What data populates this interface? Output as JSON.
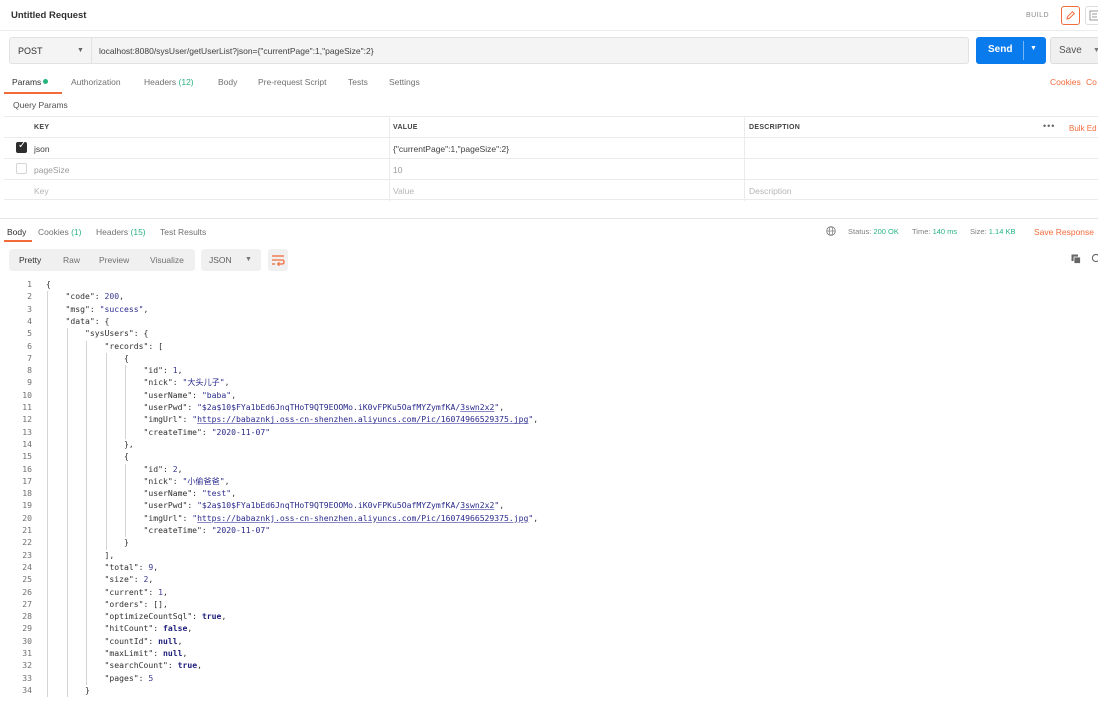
{
  "header": {
    "title": "Untitled Request",
    "build_label": "BUILD"
  },
  "request": {
    "method": "POST",
    "url": "localhost:8080/sysUser/getUserList?json={\"currentPage\":1,\"pageSize\":2}",
    "send_label": "Send",
    "save_label": "Save"
  },
  "request_tabs": {
    "params": "Params",
    "authorization": "Authorization",
    "headers": "Headers",
    "headers_count": "(12)",
    "body": "Body",
    "prerequest": "Pre-request Script",
    "tests": "Tests",
    "settings": "Settings",
    "cookies_link": "Cookies",
    "code_link": "Co"
  },
  "query_params": {
    "label": "Query Params",
    "columns": [
      "KEY",
      "VALUE",
      "DESCRIPTION"
    ],
    "bulk_edit": "Bulk Ed",
    "rows": [
      {
        "checked": true,
        "key": "json",
        "value": "{\"currentPage\":1,\"pageSize\":2}",
        "description": ""
      },
      {
        "checked": false,
        "key": "pageSize",
        "value": "10",
        "description": ""
      }
    ],
    "placeholder": {
      "key": "Key",
      "value": "Value",
      "description": "Description"
    }
  },
  "response_tabs": {
    "body": "Body",
    "cookies": "Cookies",
    "cookies_count": "(1)",
    "headers": "Headers",
    "headers_count": "(15)",
    "test_results": "Test Results"
  },
  "response_status": {
    "status_label": "Status:",
    "status_value": "200 OK",
    "time_label": "Time:",
    "time_value": "140 ms",
    "size_label": "Size:",
    "size_value": "1.14 KB",
    "save_response": "Save Response"
  },
  "view_modes": {
    "pretty": "Pretty",
    "raw": "Raw",
    "preview": "Preview",
    "visualize": "Visualize",
    "format": "JSON"
  },
  "response_body": [
    {
      "n": "1",
      "tokens": [
        {
          "c": "k",
          "t": "{"
        }
      ]
    },
    {
      "n": "2",
      "tokens": [
        {
          "c": "k",
          "t": "    \"code\": "
        },
        {
          "c": "n",
          "t": "200"
        },
        {
          "c": "k",
          "t": ","
        }
      ]
    },
    {
      "n": "3",
      "tokens": [
        {
          "c": "k",
          "t": "    \"msg\": "
        },
        {
          "c": "s",
          "t": "\"success\""
        },
        {
          "c": "k",
          "t": ","
        }
      ]
    },
    {
      "n": "4",
      "tokens": [
        {
          "c": "k",
          "t": "    \"data\": {"
        }
      ]
    },
    {
      "n": "5",
      "tokens": [
        {
          "c": "k",
          "t": "        \"sysUsers\": {"
        }
      ]
    },
    {
      "n": "6",
      "tokens": [
        {
          "c": "k",
          "t": "            \"records\": ["
        }
      ]
    },
    {
      "n": "7",
      "tokens": [
        {
          "c": "k",
          "t": "                {"
        }
      ]
    },
    {
      "n": "8",
      "tokens": [
        {
          "c": "k",
          "t": "                    \"id\": "
        },
        {
          "c": "n",
          "t": "1"
        },
        {
          "c": "k",
          "t": ","
        }
      ]
    },
    {
      "n": "9",
      "tokens": [
        {
          "c": "k",
          "t": "                    \"nick\": "
        },
        {
          "c": "s",
          "t": "\"大头儿子\""
        },
        {
          "c": "k",
          "t": ","
        }
      ]
    },
    {
      "n": "10",
      "tokens": [
        {
          "c": "k",
          "t": "                    \"userName\": "
        },
        {
          "c": "s",
          "t": "\"baba\""
        },
        {
          "c": "k",
          "t": ","
        }
      ]
    },
    {
      "n": "11",
      "tokens": [
        {
          "c": "k",
          "t": "                    \"userPwd\": "
        },
        {
          "c": "s",
          "t": "\"$2a$10$FYa1bEd6JnqTHoT9QT9EOOMo.iK0vFPKu5OafMYZymfKA/"
        },
        {
          "c": "u",
          "t": "3swn2x2"
        },
        {
          "c": "s",
          "t": "\""
        },
        {
          "c": "k",
          "t": ","
        }
      ]
    },
    {
      "n": "12",
      "tokens": [
        {
          "c": "k",
          "t": "                    \"imgUrl\": "
        },
        {
          "c": "s",
          "t": "\""
        },
        {
          "c": "u",
          "t": "https://babaznkj.oss-cn-shenzhen.aliyuncs.com/Pic/16074966529375.jpg"
        },
        {
          "c": "s",
          "t": "\""
        },
        {
          "c": "k",
          "t": ","
        }
      ]
    },
    {
      "n": "13",
      "tokens": [
        {
          "c": "k",
          "t": "                    \"createTime\": "
        },
        {
          "c": "s",
          "t": "\"2020-11-07\""
        }
      ]
    },
    {
      "n": "14",
      "tokens": [
        {
          "c": "k",
          "t": "                },"
        }
      ]
    },
    {
      "n": "15",
      "tokens": [
        {
          "c": "k",
          "t": "                {"
        }
      ]
    },
    {
      "n": "16",
      "tokens": [
        {
          "c": "k",
          "t": "                    \"id\": "
        },
        {
          "c": "n",
          "t": "2"
        },
        {
          "c": "k",
          "t": ","
        }
      ]
    },
    {
      "n": "17",
      "tokens": [
        {
          "c": "k",
          "t": "                    \"nick\": "
        },
        {
          "c": "s",
          "t": "\"小偷爸爸\""
        },
        {
          "c": "k",
          "t": ","
        }
      ]
    },
    {
      "n": "18",
      "tokens": [
        {
          "c": "k",
          "t": "                    \"userName\": "
        },
        {
          "c": "s",
          "t": "\"test\""
        },
        {
          "c": "k",
          "t": ","
        }
      ]
    },
    {
      "n": "19",
      "tokens": [
        {
          "c": "k",
          "t": "                    \"userPwd\": "
        },
        {
          "c": "s",
          "t": "\"$2a$10$FYa1bEd6JnqTHoT9QT9EOOMo.iK0vFPKu5OafMYZymfKA/"
        },
        {
          "c": "u",
          "t": "3swn2x2"
        },
        {
          "c": "s",
          "t": "\""
        },
        {
          "c": "k",
          "t": ","
        }
      ]
    },
    {
      "n": "20",
      "tokens": [
        {
          "c": "k",
          "t": "                    \"imgUrl\": "
        },
        {
          "c": "s",
          "t": "\""
        },
        {
          "c": "u",
          "t": "https://babaznkj.oss-cn-shenzhen.aliyuncs.com/Pic/16074966529375.jpg"
        },
        {
          "c": "s",
          "t": "\""
        },
        {
          "c": "k",
          "t": ","
        }
      ]
    },
    {
      "n": "21",
      "tokens": [
        {
          "c": "k",
          "t": "                    \"createTime\": "
        },
        {
          "c": "s",
          "t": "\"2020-11-07\""
        }
      ]
    },
    {
      "n": "22",
      "tokens": [
        {
          "c": "k",
          "t": "                }"
        }
      ]
    },
    {
      "n": "23",
      "tokens": [
        {
          "c": "k",
          "t": "            ],"
        }
      ]
    },
    {
      "n": "24",
      "tokens": [
        {
          "c": "k",
          "t": "            \"total\": "
        },
        {
          "c": "n",
          "t": "9"
        },
        {
          "c": "k",
          "t": ","
        }
      ]
    },
    {
      "n": "25",
      "tokens": [
        {
          "c": "k",
          "t": "            \"size\": "
        },
        {
          "c": "n",
          "t": "2"
        },
        {
          "c": "k",
          "t": ","
        }
      ]
    },
    {
      "n": "26",
      "tokens": [
        {
          "c": "k",
          "t": "            \"current\": "
        },
        {
          "c": "n",
          "t": "1"
        },
        {
          "c": "k",
          "t": ","
        }
      ]
    },
    {
      "n": "27",
      "tokens": [
        {
          "c": "k",
          "t": "            \"orders\": [],"
        }
      ]
    },
    {
      "n": "28",
      "tokens": [
        {
          "c": "k",
          "t": "            \"optimizeCountSql\": "
        },
        {
          "c": "b",
          "t": "true"
        },
        {
          "c": "k",
          "t": ","
        }
      ]
    },
    {
      "n": "29",
      "tokens": [
        {
          "c": "k",
          "t": "            \"hitCount\": "
        },
        {
          "c": "b",
          "t": "false"
        },
        {
          "c": "k",
          "t": ","
        }
      ]
    },
    {
      "n": "30",
      "tokens": [
        {
          "c": "k",
          "t": "            \"countId\": "
        },
        {
          "c": "b",
          "t": "null"
        },
        {
          "c": "k",
          "t": ","
        }
      ]
    },
    {
      "n": "31",
      "tokens": [
        {
          "c": "k",
          "t": "            \"maxLimit\": "
        },
        {
          "c": "b",
          "t": "null"
        },
        {
          "c": "k",
          "t": ","
        }
      ]
    },
    {
      "n": "32",
      "tokens": [
        {
          "c": "k",
          "t": "            \"searchCount\": "
        },
        {
          "c": "b",
          "t": "true"
        },
        {
          "c": "k",
          "t": ","
        }
      ]
    },
    {
      "n": "33",
      "tokens": [
        {
          "c": "k",
          "t": "            \"pages\": "
        },
        {
          "c": "n",
          "t": "5"
        }
      ]
    },
    {
      "n": "34",
      "tokens": [
        {
          "c": "k",
          "t": "        }"
        }
      ]
    }
  ],
  "colors": {
    "accent": "#f26b3a",
    "send": "#097bed",
    "success": "#26b47f"
  },
  "icons": {
    "edit": "pencil-icon",
    "docs": "document-icon",
    "globe": "globe-icon",
    "copy": "copy-icon",
    "search": "search-icon",
    "wrap": "wrap-lines-icon"
  }
}
